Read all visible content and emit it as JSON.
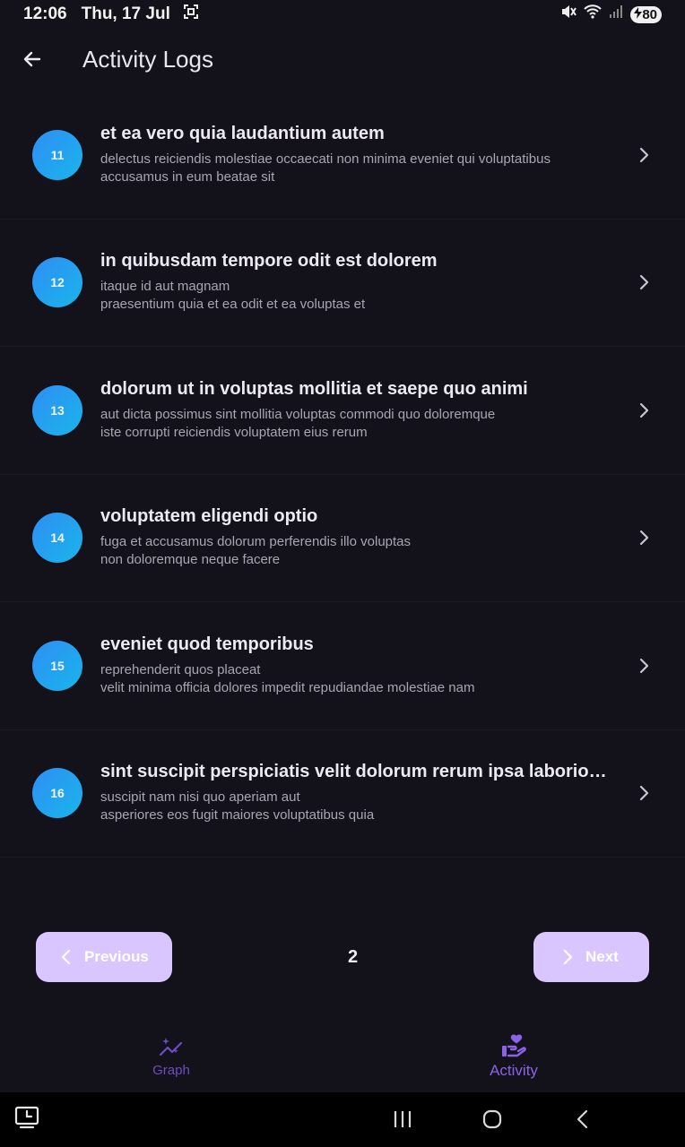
{
  "status": {
    "time": "12:06",
    "date": "Thu, 17 Jul",
    "battery": "80"
  },
  "header": {
    "title": "Activity Logs"
  },
  "logs": [
    {
      "id": "11",
      "title": "et ea vero quia laudantium autem",
      "body": "delectus reiciendis molestiae occaecati non minima eveniet qui voluptatibus\naccusamus in eum beatae sit"
    },
    {
      "id": "12",
      "title": "in quibusdam tempore odit est dolorem",
      "body": "itaque id aut magnam\npraesentium quia et ea odit et ea voluptas et"
    },
    {
      "id": "13",
      "title": "dolorum ut in voluptas mollitia et saepe quo animi",
      "body": "aut dicta possimus sint mollitia voluptas commodi quo doloremque\niste corrupti reiciendis voluptatem eius rerum"
    },
    {
      "id": "14",
      "title": "voluptatem eligendi optio",
      "body": "fuga et accusamus dolorum perferendis illo voluptas\nnon doloremque neque facere"
    },
    {
      "id": "15",
      "title": "eveniet quod temporibus",
      "body": "reprehenderit quos placeat\nvelit minima officia dolores impedit repudiandae molestiae nam"
    },
    {
      "id": "16",
      "title": "sint suscipit perspiciatis velit dolorum rerum ipsa laboriosa...",
      "body": "suscipit nam nisi quo aperiam aut\nasperiores eos fugit maiores voluptatibus quia"
    }
  ],
  "pagination": {
    "previous_label": "Previous",
    "next_label": "Next",
    "current_page": "2"
  },
  "bottom_nav": {
    "graph_label": "Graph",
    "activity_label": "Activity"
  },
  "colors": {
    "background": "#13111a",
    "avatar_gradient_start": "#2f8ef5",
    "avatar_gradient_end": "#19b5ea",
    "button_bg": "#d9c6ff",
    "nav_active": "#8a63e8"
  }
}
